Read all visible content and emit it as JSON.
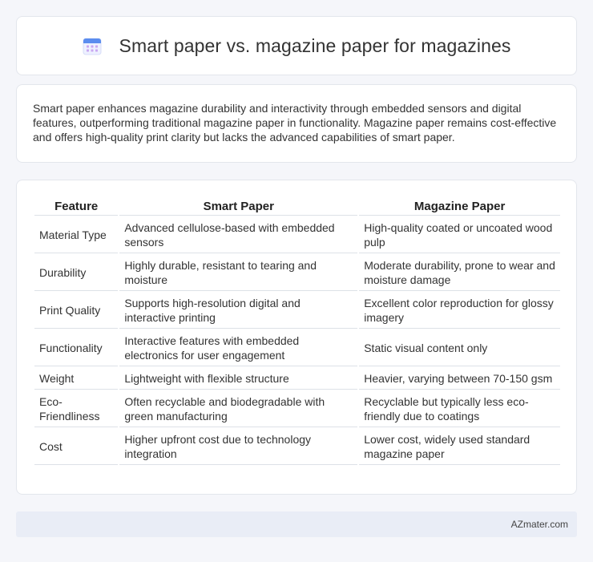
{
  "header": {
    "title": "Smart paper vs. magazine paper for magazines",
    "icon": "calendar-icon",
    "icon_colors": {
      "top": "#5b8def",
      "grid": "#c9a8f2",
      "base": "#eef1ff"
    }
  },
  "summary": {
    "text": "Smart paper enhances magazine durability and interactivity through embedded sensors and digital features, outperforming traditional magazine paper in functionality. Magazine paper remains cost-effective and offers high-quality print clarity but lacks the advanced capabilities of smart paper."
  },
  "table": {
    "headers": [
      "Feature",
      "Smart Paper",
      "Magazine Paper"
    ],
    "rows": [
      [
        "Material Type",
        "Advanced cellulose-based with embedded sensors",
        "High-quality coated or uncoated wood pulp"
      ],
      [
        "Durability",
        "Highly durable, resistant to tearing and moisture",
        "Moderate durability, prone to wear and moisture damage"
      ],
      [
        "Print Quality",
        "Supports high-resolution digital and interactive printing",
        "Excellent color reproduction for glossy imagery"
      ],
      [
        "Functionality",
        "Interactive features with embedded electronics for user engagement",
        "Static visual content only"
      ],
      [
        "Weight",
        "Lightweight with flexible structure",
        "Heavier, varying between 70-150 gsm"
      ],
      [
        "Eco-Friendliness",
        "Often recyclable and biodegradable with green manufacturing",
        "Recyclable but typically less eco-friendly due to coatings"
      ],
      [
        "Cost",
        "Higher upfront cost due to technology integration",
        "Lower cost, widely used standard magazine paper"
      ]
    ]
  },
  "footer": {
    "brand": "AZmater.com"
  }
}
